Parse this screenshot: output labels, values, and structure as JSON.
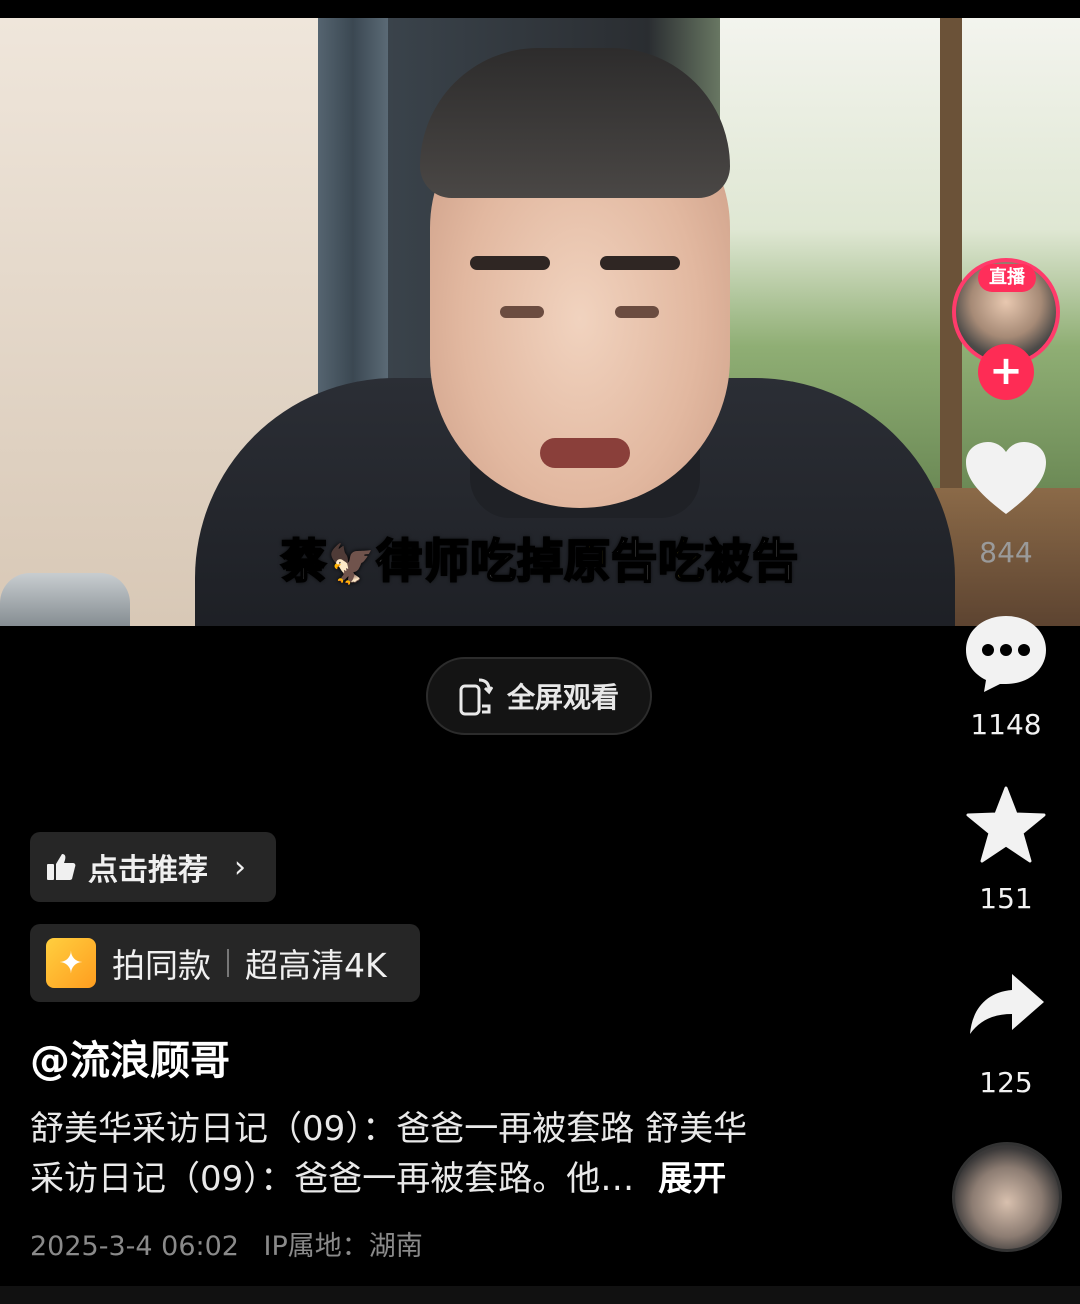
{
  "video": {
    "subtitle_parts": [
      {
        "text": "蔡",
        "color": "white"
      },
      {
        "text": "律师吃",
        "color": "white"
      },
      {
        "text": "掉原",
        "color": "yellow"
      },
      {
        "text": "告",
        "color": "white"
      },
      {
        "text": "吃被",
        "color": "yellow"
      },
      {
        "text": "告",
        "color": "white"
      }
    ],
    "subtitle_emoji_icon": "eagle-icon"
  },
  "fullscreen": {
    "label": "全屏观看",
    "icon": "rotate-phone-icon"
  },
  "rail": {
    "live_badge": "直播",
    "follow": "+",
    "likes": "844",
    "comments": "1148",
    "favorites": "151",
    "shares": "125"
  },
  "recommend": {
    "label": "点击推荐",
    "icon": "thumbs-up-icon"
  },
  "same_style": {
    "label": "拍同款",
    "hd_label": "超高清4K",
    "icon": "sparkle-icon"
  },
  "author": "@流浪顾哥",
  "description": {
    "line1": "舒美华采访日记（09）：爸爸一再被套路 舒美华",
    "line2": "采访日记（09）：爸爸一再被套路。他…",
    "expand": "展开"
  },
  "meta": {
    "datetime": "2025-3-4 06:02",
    "ip_label": "IP属地：湖南"
  },
  "colors": {
    "accent": "#fe2c55",
    "subtitle_yellow": "#ffe24d",
    "background": "#000000"
  }
}
